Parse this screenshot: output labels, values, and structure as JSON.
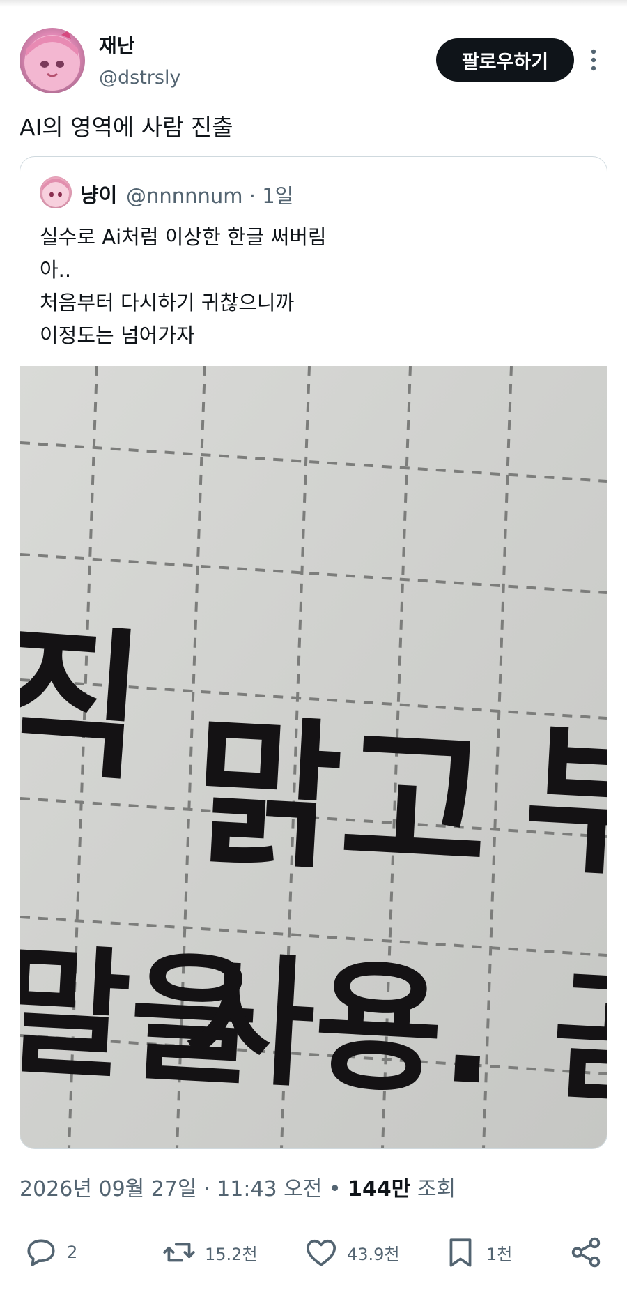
{
  "author": {
    "name": "재난",
    "handle": "@dstrsly"
  },
  "follow_label": "팔로우하기",
  "tweet_text": "AI의 영역에 사람 진출",
  "quoted": {
    "name": "냥이",
    "handle": "@nnnnnum",
    "time": "1일",
    "lines": [
      "실수로 Ai처럼 이상한 한글 써버림",
      "아..",
      "처음부터 다시하기 귀찮으니까",
      "이정도는 넘어가자"
    ],
    "image_text": {
      "row1_left": "직",
      "row1_main": "맑고",
      "row1_right": "부",
      "row2_left": "말을",
      "row2_main": "사용.",
      "row2_right": "곧"
    }
  },
  "meta": {
    "date": "2026년 09월 27일",
    "time": "11:43 오전",
    "views": "144만",
    "views_label": "조회"
  },
  "actions": {
    "replies": "2",
    "retweets": "15.2천",
    "likes": "43.9천",
    "bookmarks": "1천"
  },
  "icons": [
    "more-icon",
    "reply-icon",
    "retweet-icon",
    "like-icon",
    "bookmark-icon",
    "share-icon"
  ]
}
